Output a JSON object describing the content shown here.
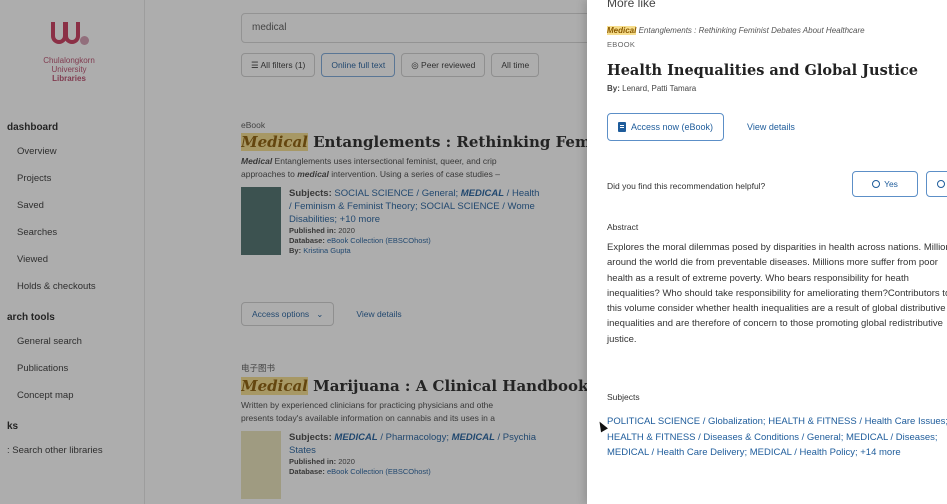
{
  "sidebar": {
    "logo_lines": [
      "Chulalongkorn",
      "University",
      "Libraries"
    ],
    "section1": {
      "heading": "dashboard",
      "items": [
        "Overview",
        "Projects",
        "Saved",
        "Searches",
        "Viewed",
        "Holds & checkouts"
      ]
    },
    "section2": {
      "heading": "arch tools",
      "items": [
        "General search",
        "Publications",
        "Concept map"
      ]
    },
    "section3": {
      "heading": "ks",
      "items": [
        ": Search other libraries"
      ]
    }
  },
  "main": {
    "search_value": "medical",
    "filters": [
      "All filters (1)",
      "Online full text",
      "Peer reviewed",
      "All time"
    ],
    "result1": {
      "type": "eBook",
      "title_hl": "Medical",
      "title_rest": " Entanglements : Rethinking Feminist Debates About Healthcare",
      "desc_hl": "Medical",
      "desc_line1_rest": " Entanglements uses intersectional feminist, queer, and crip",
      "desc_line2a": "approaches to ",
      "desc_line2_hl": "medical",
      "desc_line2b": " intervention. Using a series of case studies –",
      "subjects_label": "Subjects:",
      "subjects_line1": "SOCIAL SCIENCE / General;",
      "subjects_line1_hl": "MEDICAL",
      "subjects_line1_rest": " / Health",
      "subjects_line2": "/ Feminism & Feminist Theory;  SOCIAL SCIENCE / Wome",
      "subjects_line3": "Disabilities;  +10 more",
      "published_label": "Published in:",
      "published": "2020",
      "database_label": "Database:",
      "database": "eBook Collection (EBSCOhost)",
      "by_label": "By:",
      "by": "Kristina Gupta"
    },
    "actions": {
      "access": "Access options",
      "view": "View details"
    },
    "result2": {
      "type": "电子图书",
      "title_hl": "Medical",
      "title_rest": " Marijuana : A Clinical Handbook",
      "desc_line1": "Written by experienced clinicians for practicing physicians and othe",
      "desc_line2": "presents today's available information on cannabis and its uses in a",
      "subjects_label": "Subjects:",
      "subjects_hl1": "MEDICAL",
      "subjects_mid": " / Pharmacology;  ",
      "subjects_hl2": "MEDICAL",
      "subjects_end": " / Psychia",
      "subjects_line2": "States",
      "published_label": "Published in:",
      "published": "2020",
      "database_label": "Database:",
      "database": "eBook Collection (EBSCOhost)"
    }
  },
  "panel": {
    "more_like": "More like",
    "source_hl": "Medical",
    "source_rest": " Entanglements : Rethinking Feminist Debates About Healthcare",
    "type": "EBOOK",
    "title": "Health Inequalities and Global Justice",
    "by_label": "By:",
    "by": "Lenard, Patti Tamara",
    "access_label": "Access now (eBook)",
    "view_details": "View details",
    "helpful_q": "Did you find this recommendation helpful?",
    "yes": "Yes",
    "no": "N",
    "abstract_heading": "Abstract",
    "abstract": "Explores the moral dilemmas posed by disparities in health across nations. Millions around the world die from preventable diseases. Millions more suffer from poor health as a result of extreme poverty. Who bears responsibility for heath inequalities? Who should take responsibility for ameliorating them?Contributors to this volume consider whether health inequalities are a result of global distributive inequalities and are therefore of concern to those promoting global redistributive justice.",
    "subjects_heading": "Subjects",
    "subjects": "POLITICAL SCIENCE / Globalization;  HEALTH & FITNESS / Health Care Issues;  HEALTH & FITNESS / Diseases & Conditions / General;  MEDICAL / Diseases;  MEDICAL / Health Care Delivery;  MEDICAL / Health Policy;",
    "subjects_more": "+14 more"
  }
}
